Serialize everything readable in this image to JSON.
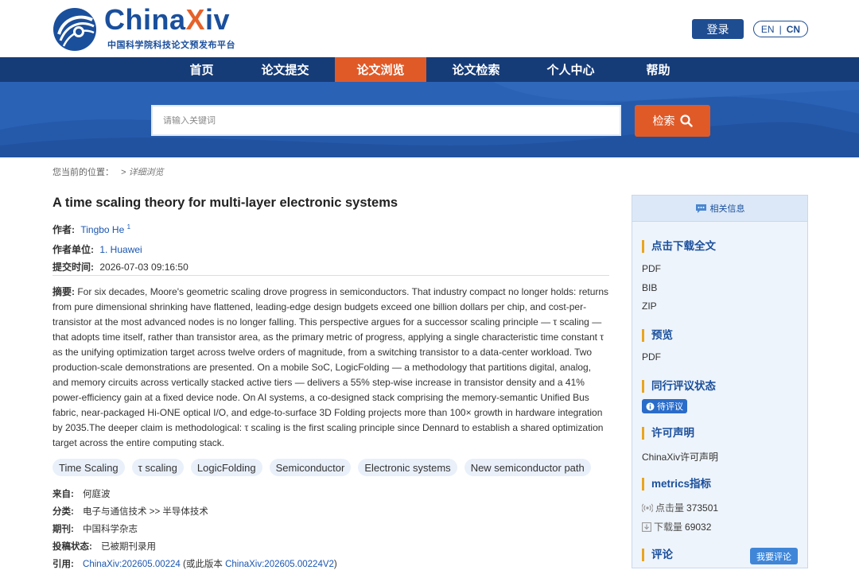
{
  "header": {
    "logo_main": "China",
    "logo_x": "X",
    "logo_tail": "iv",
    "logo_sub": "中国科学院科技论文预发布平台",
    "login_label": "登录",
    "lang_en": "EN",
    "lang_sep": "|",
    "lang_cn": "CN"
  },
  "nav": {
    "items": [
      {
        "label": "首页"
      },
      {
        "label": "论文提交"
      },
      {
        "label": "论文浏览"
      },
      {
        "label": "论文检索"
      },
      {
        "label": "个人中心"
      },
      {
        "label": "帮助"
      }
    ],
    "active": "论文浏览"
  },
  "search": {
    "placeholder": "请输入关键词",
    "button_label": "检索"
  },
  "breadcrumb": {
    "prefix": "您当前的位置：",
    "sep": ">",
    "current": "详细浏览"
  },
  "article": {
    "title": "A time scaling theory for multi-layer electronic systems",
    "author_label": "作者:",
    "author_name": "Tingbo He",
    "author_sup": "1",
    "affiliation_label": "作者单位:",
    "affiliation": "1.  Huawei",
    "submit_label": "提交时间:",
    "submit_time": "2026-07-03 09:16:50",
    "abstract_label": "摘要:",
    "abstract": "For six decades, Moore's geometric scaling drove progress in semiconductors. That industry compact no longer holds: returns from pure dimensional shrinking have flattened, leading-edge design budgets exceed one billion dollars per chip, and cost-per-transistor at the most advanced nodes is no longer falling. This perspective argues for a successor scaling principle — τ scaling — that adopts time itself, rather than transistor area, as the primary metric of progress, applying a single characteristic time constant τ as the unifying optimization target across twelve orders of magnitude, from a switching transistor to a data-center workload. Two production-scale demonstrations are presented. On a mobile SoC, LogicFolding — a methodology that partitions digital, analog, and memory circuits across vertically stacked active tiers — delivers a 55% step-wise increase in transistor density and a 41% power-efficiency gain at a fixed device node. On AI systems, a co-designed stack comprising the memory-semantic Unified Bus fabric, near-packaged Hi-ONE optical I/O, and edge-to-surface 3D Folding projects more than 100× growth in hardware integration by 2035.The deeper claim is methodological: τ scaling is the first scaling principle since Dennard to establish a shared optimization target across the entire computing stack.",
    "keywords": [
      "Time Scaling",
      "τ scaling",
      "LogicFolding",
      "Semiconductor",
      "Electronic systems",
      "New semiconductor path"
    ],
    "source_label": "来自:",
    "source": "何庭波",
    "category_label": "分类:",
    "category": "电子与通信技术 >> 半导体技术",
    "journal_label": "期刊:",
    "journal": "中国科学杂志",
    "status_label": "投稿状态:",
    "status": "已被期刊录用",
    "cite_label": "引用:",
    "cite_id": "ChinaXiv:202605.00224",
    "cite_mid": "(或此版本",
    "cite_version": "ChinaXiv:202605.00224V2",
    "cite_end": ")"
  },
  "sidebar": {
    "header": "相关信息",
    "download_title": "点击下载全文",
    "download_items": [
      "PDF",
      "BIB",
      "ZIP"
    ],
    "preview_title": "预览",
    "preview_item": "PDF",
    "peer_title": "同行评议状态",
    "peer_badge": "待评议",
    "license_title": "许可声明",
    "license_text": "ChinaXiv许可声明",
    "metrics_title": "metrics指标",
    "clicks_label": "点击量",
    "clicks_value": "373501",
    "downloads_label": "下载量",
    "downloads_value": "69032",
    "comment_title": "评论",
    "comment_button": "我要评论"
  },
  "colors": {
    "brand_blue": "#1a4f9c",
    "nav_bg": "#163c78",
    "accent_orange": "#e05a28",
    "banner_blue": "#2a62b6"
  }
}
